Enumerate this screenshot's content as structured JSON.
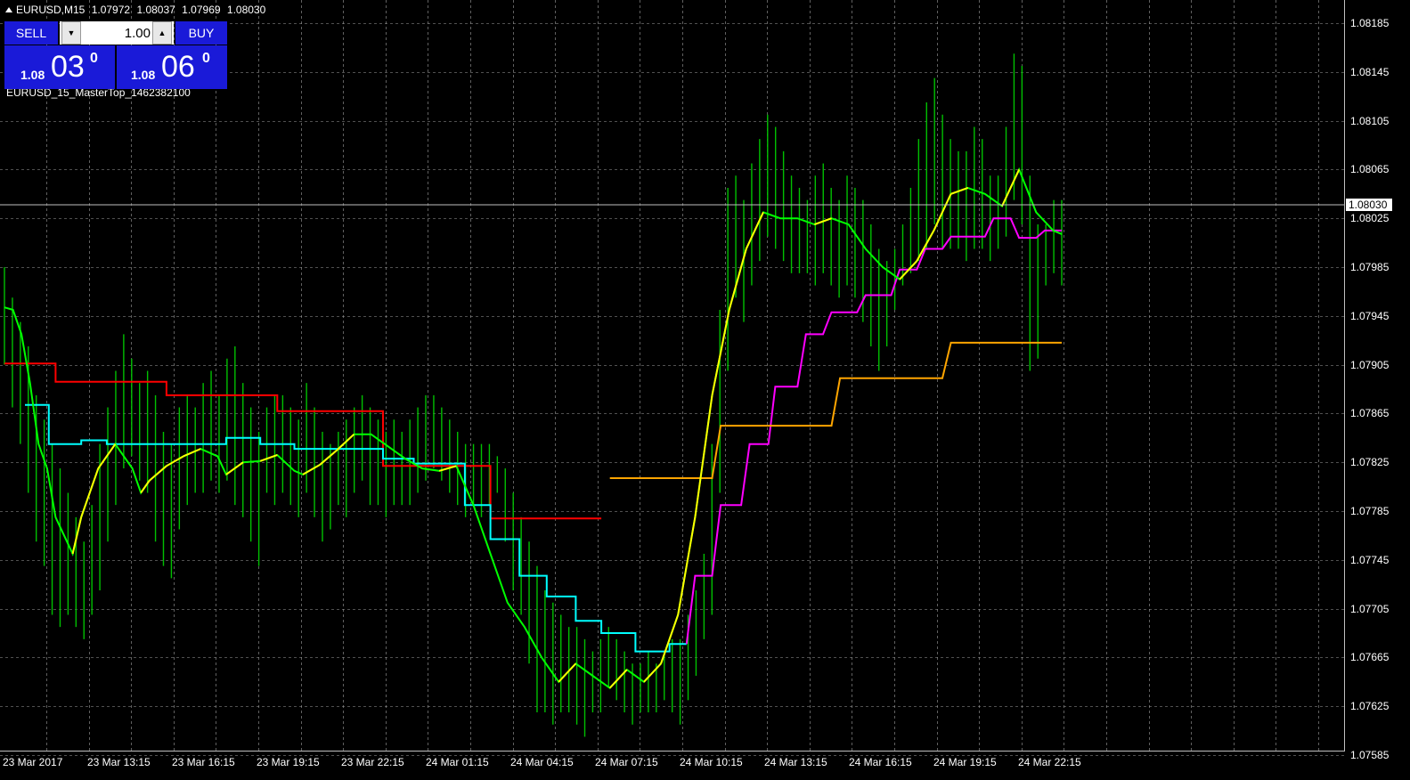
{
  "header": {
    "symbol_tf": "EURUSD,M15",
    "open": "1.07972",
    "high": "1.08037",
    "low": "1.07969",
    "close": "1.08030"
  },
  "indicator_label": "EURUSD_15_MasterTop_1462382100",
  "trade_panel": {
    "sell_label": "SELL",
    "buy_label": "BUY",
    "lot_value": "1.00",
    "sell_price": {
      "small": "1.08",
      "big": "03",
      "sup": "0"
    },
    "buy_price": {
      "small": "1.08",
      "big": "06",
      "sup": "0"
    }
  },
  "current_price": "1.08030",
  "colors": {
    "background": "#000000",
    "grid": "#a0a0a0",
    "bar": "#00c000",
    "panel": "#1a1ad8",
    "red": "#ff0000",
    "cyan": "#00ffff",
    "magenta": "#ff00ff",
    "orange": "#ffa500",
    "green_ma": "#00ff00",
    "yellow": "#ffff00",
    "gray": "#c0c0c0"
  },
  "chart_data": {
    "type": "line",
    "y_labels": [
      "1.08185",
      "1.08145",
      "1.08105",
      "1.08065",
      "1.08025",
      "1.07985",
      "1.07945",
      "1.07905",
      "1.07865",
      "1.07825",
      "1.07785",
      "1.07745",
      "1.07705",
      "1.07665",
      "1.07625",
      "1.07585"
    ],
    "y_values": [
      1.08185,
      1.08145,
      1.08105,
      1.08065,
      1.08025,
      1.07985,
      1.07945,
      1.07905,
      1.07865,
      1.07825,
      1.07785,
      1.07745,
      1.07705,
      1.07665,
      1.07625,
      1.07585
    ],
    "x_labels": [
      "23 Mar 2017",
      "23 Mar 13:15",
      "23 Mar 16:15",
      "23 Mar 19:15",
      "23 Mar 22:15",
      "24 Mar 01:15",
      "24 Mar 04:15",
      "24 Mar 07:15",
      "24 Mar 10:15",
      "24 Mar 13:15",
      "24 Mar 16:15",
      "24 Mar 19:15",
      "24 Mar 22:15"
    ],
    "ylim": [
      1.07575,
      1.08196
    ],
    "grid": true,
    "bars": [
      [
        1.07985,
        1.07905
      ],
      [
        1.0796,
        1.0787
      ],
      [
        1.0794,
        1.0784
      ],
      [
        1.0792,
        1.078
      ],
      [
        1.0788,
        1.0776
      ],
      [
        1.0786,
        1.0774
      ],
      [
        1.0784,
        1.077
      ],
      [
        1.0782,
        1.0769
      ],
      [
        1.078,
        1.077
      ],
      [
        1.0778,
        1.0769
      ],
      [
        1.0776,
        1.0768
      ],
      [
        1.0779,
        1.077
      ],
      [
        1.0784,
        1.0772
      ],
      [
        1.0787,
        1.0776
      ],
      [
        1.079,
        1.0779
      ],
      [
        1.0793,
        1.0782
      ],
      [
        1.0791,
        1.0783
      ],
      [
        1.0789,
        1.0781
      ],
      [
        1.079,
        1.078
      ],
      [
        1.0788,
        1.0776
      ],
      [
        1.0785,
        1.0774
      ],
      [
        1.0784,
        1.0773
      ],
      [
        1.0787,
        1.0777
      ],
      [
        1.0788,
        1.0779
      ],
      [
        1.0787,
        1.078
      ],
      [
        1.0789,
        1.078
      ],
      [
        1.079,
        1.0781
      ],
      [
        1.0788,
        1.078
      ],
      [
        1.0791,
        1.0781
      ],
      [
        1.0792,
        1.0779
      ],
      [
        1.0789,
        1.0778
      ],
      [
        1.0787,
        1.0776
      ],
      [
        1.0785,
        1.0774
      ],
      [
        1.0787,
        1.078
      ],
      [
        1.0788,
        1.0779
      ],
      [
        1.0788,
        1.078
      ],
      [
        1.0787,
        1.0779
      ],
      [
        1.0786,
        1.0778
      ],
      [
        1.0789,
        1.078
      ],
      [
        1.0787,
        1.0778
      ],
      [
        1.0785,
        1.0776
      ],
      [
        1.0784,
        1.0777
      ],
      [
        1.0785,
        1.0779
      ],
      [
        1.0786,
        1.0778
      ],
      [
        1.0787,
        1.078
      ],
      [
        1.0788,
        1.0781
      ],
      [
        1.0787,
        1.0779
      ],
      [
        1.0786,
        1.0779
      ],
      [
        1.0785,
        1.0778
      ],
      [
        1.0786,
        1.0779
      ],
      [
        1.0785,
        1.0779
      ],
      [
        1.0786,
        1.0779
      ],
      [
        1.0787,
        1.078
      ],
      [
        1.0788,
        1.0781
      ],
      [
        1.0788,
        1.0782
      ],
      [
        1.0787,
        1.0781
      ],
      [
        1.0786,
        1.078
      ],
      [
        1.0785,
        1.0779
      ],
      [
        1.0784,
        1.0778
      ],
      [
        1.0784,
        1.0779
      ],
      [
        1.0784,
        1.0778
      ],
      [
        1.0784,
        1.0779
      ],
      [
        1.0783,
        1.078
      ],
      [
        1.0782,
        1.0776
      ],
      [
        1.078,
        1.0772
      ],
      [
        1.0778,
        1.077
      ],
      [
        1.0776,
        1.0766
      ],
      [
        1.0774,
        1.0762
      ],
      [
        1.0772,
        1.0762
      ],
      [
        1.0771,
        1.0761
      ],
      [
        1.077,
        1.0762
      ],
      [
        1.0769,
        1.0762
      ],
      [
        1.0769,
        1.0761
      ],
      [
        1.0768,
        1.076
      ],
      [
        1.0767,
        1.0762
      ],
      [
        1.0768,
        1.0762
      ],
      [
        1.0769,
        1.0764
      ],
      [
        1.0768,
        1.0763
      ],
      [
        1.0767,
        1.0762
      ],
      [
        1.0766,
        1.0761
      ],
      [
        1.0766,
        1.0762
      ],
      [
        1.0767,
        1.0762
      ],
      [
        1.0766,
        1.0762
      ],
      [
        1.0767,
        1.0763
      ],
      [
        1.0768,
        1.0762
      ],
      [
        1.0768,
        1.0761
      ],
      [
        1.077,
        1.0763
      ],
      [
        1.0772,
        1.0765
      ],
      [
        1.0775,
        1.0768
      ],
      [
        1.0784,
        1.077
      ],
      [
        1.0795,
        1.078
      ],
      [
        1.0805,
        1.079
      ],
      [
        1.0806,
        1.0796
      ],
      [
        1.0804,
        1.0794
      ],
      [
        1.0807,
        1.0797
      ],
      [
        1.0809,
        1.0799
      ],
      [
        1.0811,
        1.0801
      ],
      [
        1.081,
        1.08
      ],
      [
        1.0808,
        1.0799
      ],
      [
        1.0806,
        1.0798
      ],
      [
        1.0805,
        1.0798
      ],
      [
        1.0804,
        1.0798
      ],
      [
        1.0806,
        1.0797
      ],
      [
        1.0807,
        1.0798
      ],
      [
        1.0805,
        1.0797
      ],
      [
        1.0804,
        1.0796
      ],
      [
        1.0806,
        1.0797
      ],
      [
        1.0805,
        1.0796
      ],
      [
        1.0804,
        1.0794
      ],
      [
        1.0802,
        1.0792
      ],
      [
        1.08,
        1.079
      ],
      [
        1.0799,
        1.0792
      ],
      [
        1.08,
        1.0795
      ],
      [
        1.0802,
        1.0797
      ],
      [
        1.0805,
        1.0798
      ],
      [
        1.0809,
        1.0799
      ],
      [
        1.0812,
        1.08
      ],
      [
        1.0814,
        1.0802
      ],
      [
        1.0811,
        1.08
      ],
      [
        1.0809,
        1.08
      ],
      [
        1.0808,
        1.08
      ],
      [
        1.0808,
        1.0799
      ],
      [
        1.081,
        1.08
      ],
      [
        1.0809,
        1.08
      ],
      [
        1.0806,
        1.0799
      ],
      [
        1.0806,
        1.08
      ],
      [
        1.081,
        1.0801
      ],
      [
        1.0816,
        1.0804
      ],
      [
        1.0815,
        1.0802
      ],
      [
        1.0806,
        1.079
      ],
      [
        1.0802,
        1.0791
      ],
      [
        1.0802,
        1.0797
      ],
      [
        1.0804,
        1.0798
      ],
      [
        1.0804,
        1.0797
      ]
    ],
    "series": [
      {
        "color": "red",
        "values": [
          [
            0,
            1.07906
          ],
          [
            30,
            1.07906
          ],
          [
            30,
            1.07891
          ],
          [
            95,
            1.07891
          ],
          [
            95,
            1.0788
          ],
          [
            160,
            1.0788
          ],
          [
            160,
            1.07867
          ],
          [
            222,
            1.07867
          ],
          [
            222,
            1.07822
          ],
          [
            285,
            1.07822
          ],
          [
            285,
            1.07779
          ],
          [
            350,
            1.07779
          ]
        ]
      },
      {
        "color": "cyan",
        "values": [
          [
            12,
            1.07872
          ],
          [
            26,
            1.07872
          ],
          [
            26,
            1.0784
          ],
          [
            45,
            1.0784
          ],
          [
            45,
            1.07843
          ],
          [
            60,
            1.07843
          ],
          [
            60,
            1.0784
          ],
          [
            65,
            1.0784
          ],
          [
            75,
            1.0784
          ],
          [
            75,
            1.0784
          ],
          [
            95,
            1.0784
          ],
          [
            95,
            1.0784
          ],
          [
            110,
            1.0784
          ],
          [
            110,
            1.0784
          ],
          [
            130,
            1.0784
          ],
          [
            130,
            1.07845
          ],
          [
            150,
            1.07845
          ],
          [
            150,
            1.0784
          ],
          [
            170,
            1.0784
          ],
          [
            170,
            1.07836
          ],
          [
            222,
            1.07836
          ],
          [
            222,
            1.07828
          ],
          [
            240,
            1.07828
          ],
          [
            240,
            1.07824
          ],
          [
            270,
            1.07824
          ],
          [
            270,
            1.0779
          ],
          [
            285,
            1.0779
          ],
          [
            285,
            1.07762
          ],
          [
            302,
            1.07762
          ],
          [
            302,
            1.07732
          ],
          [
            318,
            1.07732
          ],
          [
            318,
            1.07715
          ],
          [
            335,
            1.07715
          ],
          [
            335,
            1.07695
          ],
          [
            350,
            1.07695
          ],
          [
            350,
            1.07685
          ],
          [
            370,
            1.07685
          ],
          [
            370,
            1.0767
          ],
          [
            390,
            1.0767
          ],
          [
            390,
            1.07676
          ],
          [
            400,
            1.07676
          ]
        ]
      },
      {
        "color": "magenta",
        "values": [
          [
            400,
            1.07676
          ],
          [
            405,
            1.07732
          ],
          [
            415,
            1.07732
          ],
          [
            420,
            1.0779
          ],
          [
            432,
            1.0779
          ],
          [
            437,
            1.0784
          ],
          [
            448,
            1.0784
          ],
          [
            452,
            1.07887
          ],
          [
            465,
            1.07887
          ],
          [
            470,
            1.0793
          ],
          [
            480,
            1.0793
          ],
          [
            485,
            1.07948
          ],
          [
            500,
            1.07948
          ],
          [
            505,
            1.07962
          ],
          [
            520,
            1.07962
          ],
          [
            525,
            1.07983
          ],
          [
            535,
            1.07983
          ],
          [
            540,
            1.08
          ],
          [
            550,
            1.08
          ],
          [
            555,
            1.0801
          ],
          [
            575,
            1.0801
          ],
          [
            580,
            1.08025
          ],
          [
            590,
            1.08025
          ],
          [
            595,
            1.08009
          ],
          [
            605,
            1.08009
          ],
          [
            610,
            1.08015
          ],
          [
            620,
            1.08015
          ]
        ]
      },
      {
        "color": "orange",
        "values": [
          [
            355,
            1.07812
          ],
          [
            415,
            1.07812
          ],
          [
            420,
            1.07855
          ],
          [
            485,
            1.07855
          ],
          [
            490,
            1.07894
          ],
          [
            550,
            1.07894
          ],
          [
            555,
            1.07923
          ],
          [
            620,
            1.07923
          ]
        ]
      },
      {
        "color": "green",
        "values": [
          [
            0,
            1.07952
          ],
          [
            5,
            1.0795
          ],
          [
            10,
            1.0793
          ],
          [
            15,
            1.0789
          ],
          [
            20,
            1.0784
          ],
          [
            25,
            1.0782
          ],
          [
            30,
            1.0778
          ],
          [
            35,
            1.07765
          ],
          [
            40,
            1.0775
          ],
          [
            45,
            1.0778
          ],
          [
            55,
            1.0782
          ],
          [
            65,
            1.0784
          ],
          [
            75,
            1.0782
          ],
          [
            80,
            1.078
          ],
          [
            85,
            1.0781
          ],
          [
            95,
            1.07822
          ],
          [
            105,
            1.0783
          ],
          [
            115,
            1.07836
          ],
          [
            125,
            1.0783
          ],
          [
            130,
            1.07815
          ],
          [
            140,
            1.07825
          ],
          [
            150,
            1.07826
          ],
          [
            160,
            1.07831
          ],
          [
            170,
            1.07818
          ],
          [
            175,
            1.07815
          ],
          [
            185,
            1.07823
          ],
          [
            195,
            1.07835
          ],
          [
            205,
            1.07848
          ],
          [
            215,
            1.07848
          ],
          [
            225,
            1.07838
          ],
          [
            235,
            1.07828
          ],
          [
            245,
            1.0782
          ],
          [
            255,
            1.07818
          ],
          [
            265,
            1.07822
          ],
          [
            275,
            1.0779
          ],
          [
            285,
            1.0775
          ],
          [
            295,
            1.0771
          ],
          [
            305,
            1.0769
          ],
          [
            315,
            1.07665
          ],
          [
            325,
            1.07645
          ],
          [
            335,
            1.0766
          ],
          [
            345,
            1.0765
          ],
          [
            355,
            1.0764
          ],
          [
            365,
            1.07655
          ],
          [
            375,
            1.07645
          ],
          [
            385,
            1.0766
          ],
          [
            395,
            1.077
          ],
          [
            405,
            1.0778
          ],
          [
            415,
            1.0788
          ],
          [
            425,
            1.0795
          ],
          [
            435,
            1.08
          ],
          [
            445,
            1.0803
          ],
          [
            455,
            1.08025
          ],
          [
            465,
            1.08025
          ],
          [
            475,
            1.0802
          ],
          [
            485,
            1.08025
          ],
          [
            495,
            1.0802
          ],
          [
            505,
            1.08
          ],
          [
            515,
            1.07985
          ],
          [
            525,
            1.07975
          ],
          [
            535,
            1.0799
          ],
          [
            545,
            1.08015
          ],
          [
            555,
            1.08045
          ],
          [
            565,
            1.0805
          ],
          [
            575,
            1.08045
          ],
          [
            585,
            1.08035
          ],
          [
            595,
            1.08065
          ],
          [
            605,
            1.0803
          ],
          [
            615,
            1.08015
          ],
          [
            620,
            1.08012
          ]
        ]
      }
    ]
  }
}
